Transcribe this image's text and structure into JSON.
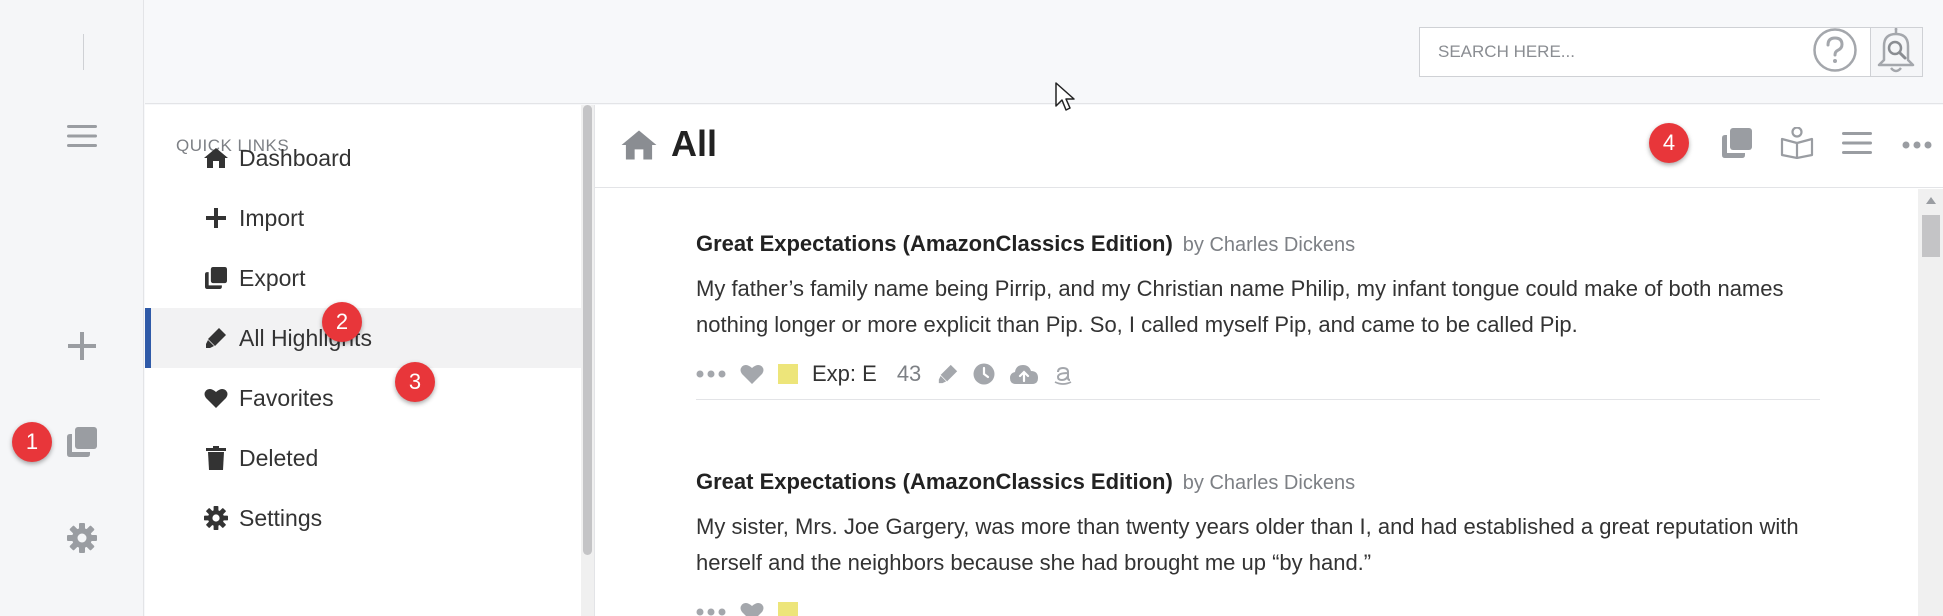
{
  "rail": {
    "icons": [
      "menu-icon",
      "plus-icon",
      "copy-icon",
      "gear-icon"
    ]
  },
  "header": {
    "search_placeholder": "SEARCH HERE...",
    "icons": [
      "search-icon",
      "help-icon",
      "bell-icon"
    ]
  },
  "quick_links": {
    "title": "QUICK LINKS",
    "items": [
      {
        "label": "Dashboard",
        "icon": "home-icon"
      },
      {
        "label": "Import",
        "icon": "plus-icon"
      },
      {
        "label": "Export",
        "icon": "copy-icon"
      },
      {
        "label": "All Highlights",
        "icon": "highlighter-icon",
        "active": true
      },
      {
        "label": "Favorites",
        "icon": "heart-icon"
      },
      {
        "label": "Deleted",
        "icon": "trash-icon"
      },
      {
        "label": "Settings",
        "icon": "gear-icon"
      }
    ]
  },
  "badges": [
    "1",
    "2",
    "3",
    "4"
  ],
  "main": {
    "title": "All",
    "toolbar_icons": [
      "copy-icon",
      "book-reader-icon",
      "list-icon",
      "more-icon"
    ],
    "highlights": [
      {
        "book": "Great Expectations (AmazonClassics Edition)",
        "author": "by Charles Dickens",
        "text": "My father’s family name being Pirrip, and my Christian name Philip, my infant tongue could make of both names nothing longer or more explicit than Pip. So, I called myself Pip, and came to be called Pip.",
        "exp": "Exp: E",
        "count": "43"
      },
      {
        "book": "Great Expectations (AmazonClassics Edition)",
        "author": "by Charles Dickens",
        "text": "My sister, Mrs. Joe Gargery, was more than twenty years older than I, and had established a great reputation with herself and the neighbors because she had brought me up “by hand.”"
      }
    ]
  },
  "colors": {
    "accent": "#2f5aa8",
    "badge": "#e8363a",
    "highlight_swatch": "#ede57a"
  }
}
